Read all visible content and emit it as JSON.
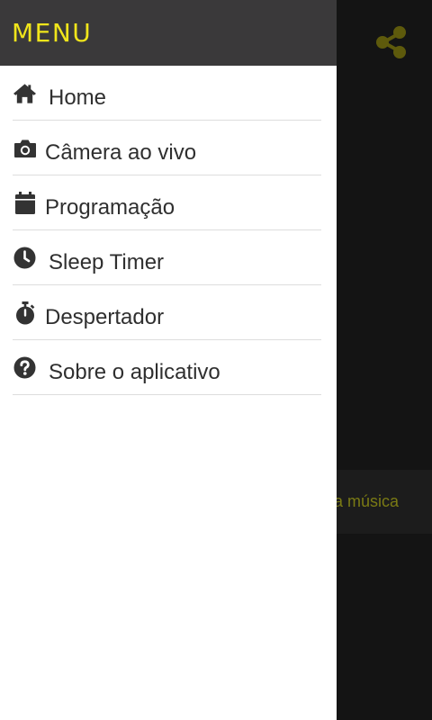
{
  "drawer": {
    "title": "MENU",
    "items": [
      {
        "label": "Home",
        "icon": "home-icon"
      },
      {
        "label": "Câmera ao vivo",
        "icon": "camera-icon"
      },
      {
        "label": "Programação",
        "icon": "calendar-icon"
      },
      {
        "label": "Sleep Timer",
        "icon": "clock-icon"
      },
      {
        "label": "Despertador",
        "icon": "stopwatch-icon"
      },
      {
        "label": "Sobre o aplicativo",
        "icon": "question-circle-icon"
      }
    ]
  },
  "background": {
    "band_text": "a música",
    "share_icon": "share-icon"
  },
  "colors": {
    "drawer_header": "#3a393a",
    "accent_yellow": "#f0e51b",
    "background": "#141414",
    "text": "#2f2f2f"
  }
}
